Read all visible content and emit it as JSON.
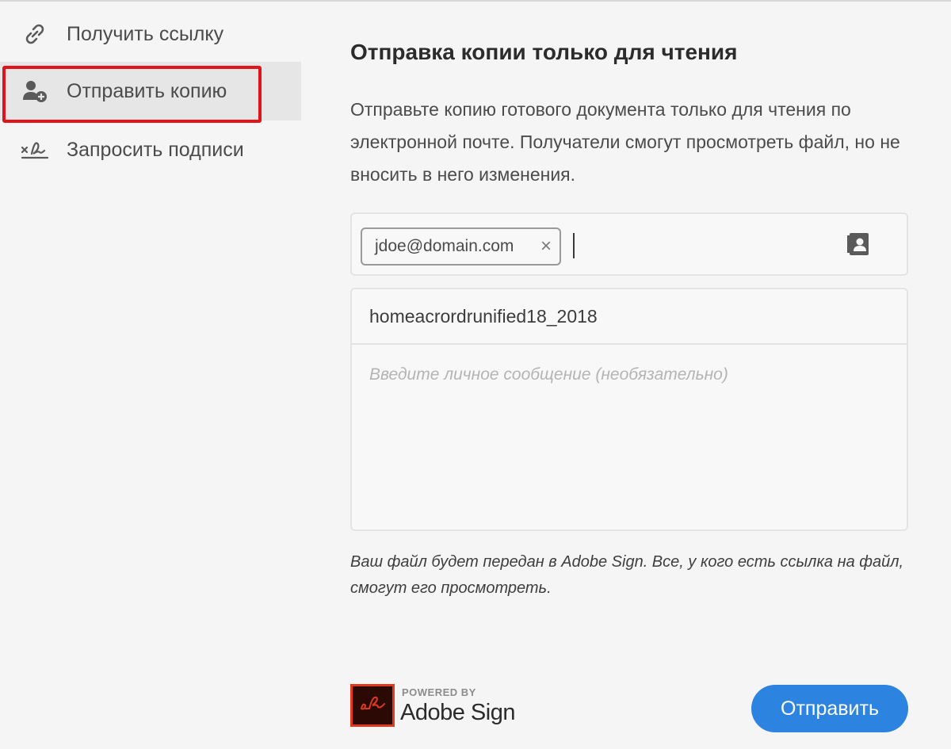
{
  "sidebar": {
    "items": [
      {
        "label": "Получить ссылку",
        "icon": "link-icon",
        "active": false
      },
      {
        "label": "Отправить копию",
        "icon": "add-person-icon",
        "active": true
      },
      {
        "label": "Запросить подписи",
        "icon": "signature-icon",
        "active": false
      }
    ],
    "highlight_color": "#e1131b"
  },
  "main": {
    "title": "Отправка копии только для чтения",
    "description": "Отправьте копию готового документа только для чтения по электронной почте. Получатели смогут просмотреть файл, но не вносить в него изменения.",
    "recipients": [
      {
        "email": "jdoe@domain.com",
        "remove_glyph": "×"
      }
    ],
    "subject": "homeacrordrunified18_2018",
    "message_placeholder": "Введите личное сообщение (необязательно)",
    "footnote": "Ваш файл будет передан в Adobe Sign. Все, у кого есть ссылка на файл, смогут его просмотреть."
  },
  "footer": {
    "powered_by": "POWERED BY",
    "brand": "Adobe Sign",
    "send_label": "Отправить",
    "accent_color": "#2d84e0",
    "logo_color": "#e03a1e"
  }
}
